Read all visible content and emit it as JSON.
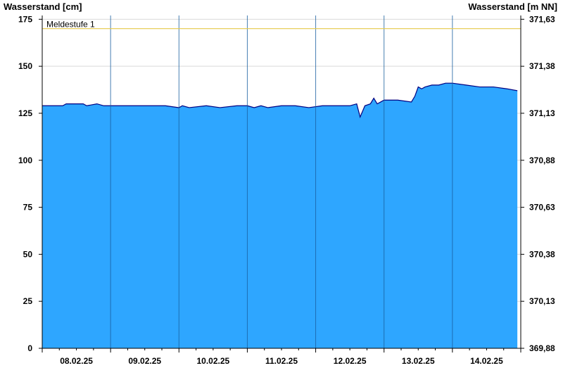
{
  "chart_data": {
    "type": "area",
    "ylabel_left": "Wasserstand [cm]",
    "ylabel_right": "Wasserstand [m NN]",
    "ylim": [
      0,
      177
    ],
    "yticks_left": [
      0,
      25,
      50,
      75,
      100,
      125,
      150,
      175
    ],
    "yticks_right": [
      "369,88",
      "370,13",
      "370,38",
      "370,63",
      "370,88",
      "371,13",
      "371,38",
      "371,63"
    ],
    "x_days": [
      "08.02.25",
      "09.02.25",
      "10.02.25",
      "11.02.25",
      "12.02.25",
      "13.02.25",
      "14.02.25"
    ],
    "threshold": {
      "label": "Meldestufe 1",
      "value": 170
    },
    "fill_color": "#2ea6ff",
    "line_color": "#000080",
    "threshold_color": "#e6c84a",
    "grid": true,
    "series": [
      {
        "x": [
          0,
          0.3,
          0.35,
          0.6,
          0.65,
          0.8,
          0.9,
          1.2,
          1.4,
          1.8,
          2.0,
          2.05,
          2.15,
          2.4,
          2.6,
          2.85,
          3.0,
          3.1,
          3.2,
          3.3,
          3.5,
          3.7,
          3.9,
          4.1,
          4.3,
          4.5,
          4.6,
          4.65,
          4.72,
          4.8,
          4.85,
          4.9,
          4.95,
          5.0,
          5.2,
          5.4,
          5.45,
          5.5,
          5.55,
          5.6,
          5.7,
          5.8,
          5.9,
          6.0,
          6.2,
          6.4,
          6.6,
          6.8,
          6.95
        ],
        "y": [
          129,
          129,
          130,
          130,
          129,
          130,
          129,
          129,
          129,
          129,
          128,
          129,
          128,
          129,
          128,
          129,
          129,
          128,
          129,
          128,
          129,
          129,
          128,
          129,
          129,
          129,
          130,
          123,
          129,
          130,
          133,
          130,
          131,
          132,
          132,
          131,
          134,
          139,
          138,
          139,
          140,
          140,
          141,
          141,
          140,
          139,
          139,
          138,
          137
        ]
      }
    ]
  }
}
